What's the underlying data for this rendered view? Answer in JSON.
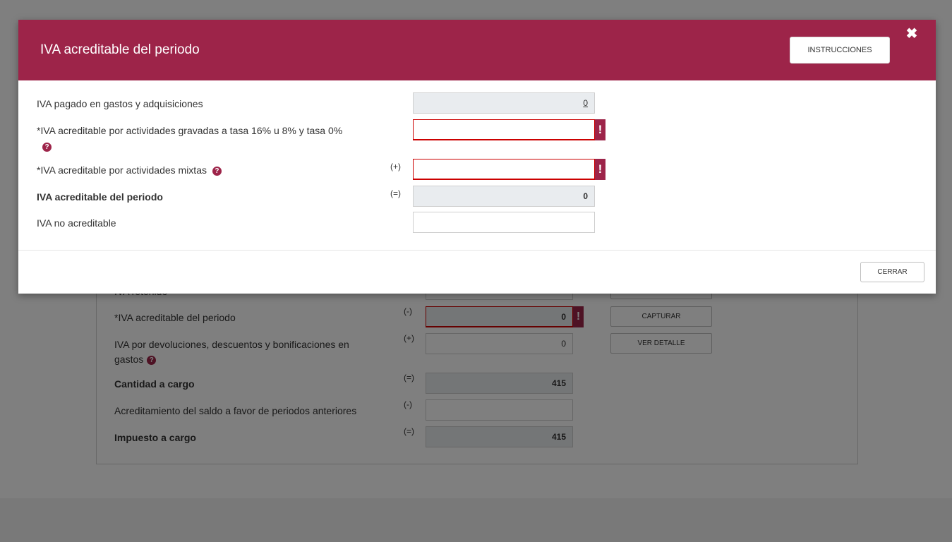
{
  "background": {
    "rows": [
      {
        "label": "IVA retenido",
        "sign": "",
        "value": "",
        "button": ""
      },
      {
        "label": "*IVA acreditable del periodo",
        "sign": "(-)",
        "value": "0",
        "button": "CAPTURAR"
      },
      {
        "label": "IVA por devoluciones, descuentos y bonificaciones en gastos",
        "sign": "(+)",
        "value": "0",
        "button": "VER DETALLE"
      },
      {
        "label": "Cantidad a cargo",
        "sign": "(=)",
        "value": "415",
        "button": ""
      },
      {
        "label": "Acreditamiento del saldo a favor de periodos anteriores",
        "sign": "(-)",
        "value": "",
        "button": ""
      },
      {
        "label": "Impuesto a cargo",
        "sign": "(=)",
        "value": "415",
        "button": ""
      }
    ]
  },
  "modal": {
    "title": "IVA acreditable del periodo",
    "instructions_label": "INSTRUCCIONES",
    "close_symbol": "✖",
    "rows": [
      {
        "label": "IVA pagado en gastos y adquisiciones",
        "sign": "",
        "value": "0"
      },
      {
        "label": "*IVA acreditable por actividades gravadas a tasa 16% u 8% y tasa 0%",
        "sign": "",
        "value": ""
      },
      {
        "label": "*IVA acreditable por actividades mixtas",
        "sign": "(+)",
        "value": ""
      },
      {
        "label": "IVA acreditable del periodo",
        "sign": "(=)",
        "value": "0"
      },
      {
        "label": "IVA no acreditable",
        "sign": "",
        "value": ""
      }
    ],
    "error_symbol": "!",
    "help_symbol": "?",
    "cerrar_label": "CERRAR"
  },
  "colors": {
    "brand": "#9d2449",
    "error": "#cc0000",
    "readonly_bg": "#e9ecef"
  }
}
